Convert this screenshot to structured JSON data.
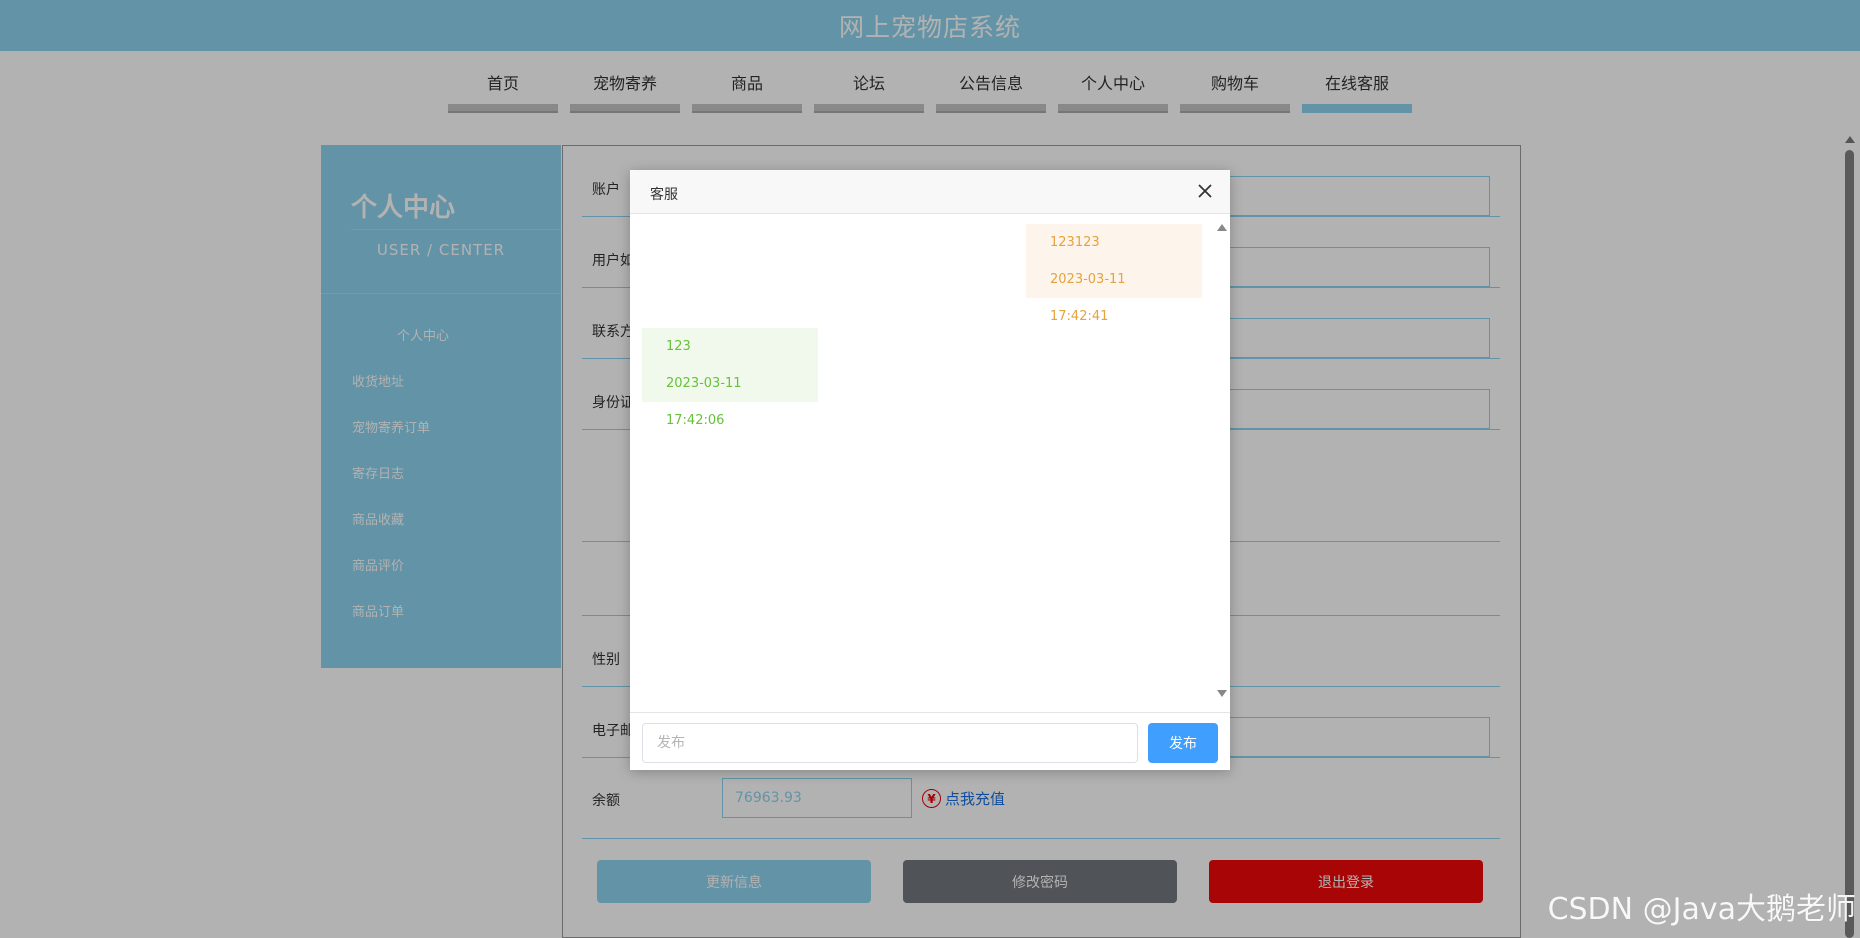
{
  "app": {
    "title": "网上宠物店系统"
  },
  "nav": {
    "items": [
      {
        "label": "首页"
      },
      {
        "label": "宠物寄养"
      },
      {
        "label": "商品"
      },
      {
        "label": "论坛"
      },
      {
        "label": "公告信息"
      },
      {
        "label": "个人中心"
      },
      {
        "label": "购物车"
      },
      {
        "label": "在线客服"
      }
    ],
    "active_index": 7
  },
  "sidebar": {
    "title": "个人中心",
    "subtitle": "USER / CENTER",
    "items": [
      {
        "label": "个人中心"
      },
      {
        "label": "收货地址"
      },
      {
        "label": "宠物寄养订单"
      },
      {
        "label": "寄存日志"
      },
      {
        "label": "商品收藏"
      },
      {
        "label": "商品评价"
      },
      {
        "label": "商品订单"
      }
    ]
  },
  "form": {
    "fields": [
      {
        "label": "账户"
      },
      {
        "label": "用户如"
      },
      {
        "label": "联系方"
      },
      {
        "label": "身份证"
      },
      {
        "label": ""
      },
      {
        "label": ""
      },
      {
        "label": "性别"
      },
      {
        "label": "电子邮"
      }
    ],
    "balance_label": "余额",
    "balance_value": "76963.93",
    "recharge_label": "点我充值",
    "recharge_icon": "yen-icon"
  },
  "buttons": {
    "update": "更新信息",
    "change_password": "修改密码",
    "logout": "退出登录"
  },
  "dialog": {
    "title": "客服",
    "close_icon": "close-icon",
    "messages": [
      {
        "side": "right",
        "text": "123123",
        "time": "2023-03-11 17:42:41"
      },
      {
        "side": "left",
        "text": "123",
        "time": "2023-03-11 17:42:06"
      }
    ],
    "input_placeholder": "发布",
    "send_label": "发布"
  },
  "colors": {
    "accent": "#8fd3ee",
    "send_button": "#409eff",
    "logout": "#f10a0a",
    "right_bubble_bg": "#fdf5ec",
    "right_bubble_text": "#e6a23c",
    "left_bubble_bg": "#f0f9eb",
    "left_bubble_text": "#67c23a"
  },
  "watermark": "CSDN @Java大鹅老师"
}
